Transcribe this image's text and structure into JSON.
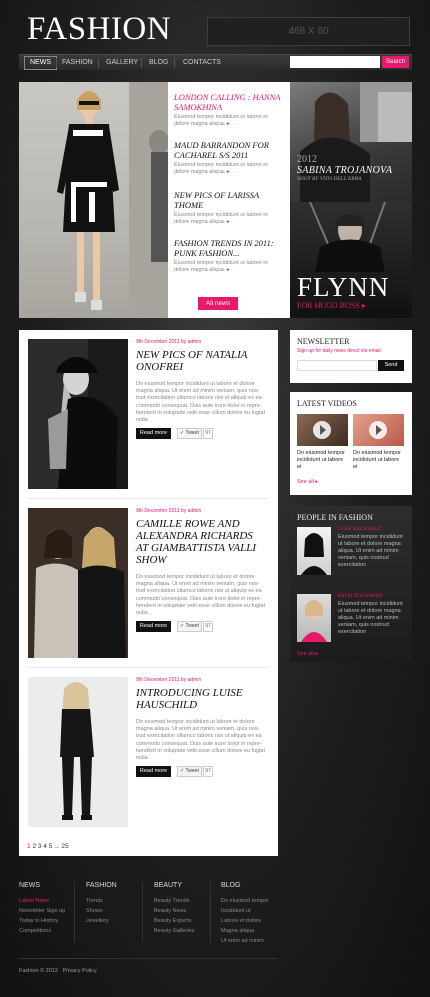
{
  "logo": "FASHION",
  "banner": "468 X 60",
  "nav": [
    "NEWS",
    "FASHION",
    "GALLERY",
    "BLOG",
    "CONTACTS"
  ],
  "search": {
    "button": "Search"
  },
  "hero": {
    "items": [
      {
        "title": "LONDON CALLING : HANNA SAMOKHINA",
        "desc": "Eiusmod tempor incididunt ut labore et dolore magna aliqua.",
        "highlight": true
      },
      {
        "title": "MAUD BARRANDON FOR CACHAREL S/S 2011",
        "desc": "Eiusmod tempor incididunt ut labore et dolore magna aliqua."
      },
      {
        "title": "NEW PICS OF LARISSA THOME",
        "desc": "Eiusmod tempor incididunt ut labore et dolore magna aliqua."
      },
      {
        "title": "FASHION TRENDS IN 2011: PUNK FASHION...",
        "desc": "Eiusmod tempor incididunt ut labore et dolore magna aliqua."
      }
    ],
    "all_news": "All news",
    "side1": {
      "year": "2012",
      "name": "SABINA TROJANOVA",
      "sub": "SHOT BY VITO DELL'ERBA"
    },
    "side2": {
      "name": "FLYNN",
      "sub": "FOR HUGO BOSS"
    }
  },
  "articles": [
    {
      "date": "9th December 2011 by admin",
      "title": "NEW PICS OF NATALIA ONOFREI",
      "text": "Do eiusmod tempor incididunt ut labore et dolore magna aliqua. Ut enim ad minim veniam, quis nos-trud exercitation ullamco laboris nisi ut aliquip ex ea commodo consequat. Duis aute irure dolor in repre-henderit in voluptate velit esse cillum dolore eu fugiat nulla.",
      "read_more": "Read more",
      "tweet": "Tweet",
      "count": "97"
    },
    {
      "date": "9th December 2011 by admin",
      "title": "CAMILLE ROWE AND ALEXANDRA RICHARDS AT GIAMBATTISTA VALLI SHOW",
      "text": "Do eiusmod tempor incididunt ut labore et dolore magna aliqua. Ut enim ad minim veniam, quis nos-trud exercitation ullamco laboris nisi ut aliquip ex ea commodo consequat. Duis aute irure dolor in repre-henderit in voluptate velit esse cillum dolore eu fugiat nulla.",
      "read_more": "Read more",
      "tweet": "Tweet",
      "count": "97"
    },
    {
      "date": "9th December 2011 by admin",
      "title": "INTRODUCING LUISE HAUSCHILD",
      "text": "Do eiusmod tempor incididunt ut labore et dolore magna aliqua. Ut enim ad minim veniam, quis nos-trud exercitation ullamco laboris nisi ut aliquip ex ea commodo consequat. Duis aute irure dolor in repre-henderit in voluptate velit esse cillum dolore eu fugiat nulla.",
      "read_more": "Read more",
      "tweet": "Tweet",
      "count": "97"
    }
  ],
  "pagination": {
    "current": "1",
    "rest": "2 3 4 5 ... 25"
  },
  "newsletter": {
    "title": "NEWSLETTER",
    "sub": "Sign up for daily news direct via email",
    "button": "Send"
  },
  "videos": {
    "title": "LATEST VIDEOS",
    "items": [
      "Do eiusmod tempor incididunt ut labore et",
      "Do eiusmod tempor incididunt ut labore et"
    ],
    "see_all": "See all"
  },
  "people": {
    "title": "PEOPLE IN FASHION",
    "items": [
      {
        "name": "LUISE HAUSCHILD",
        "desc": "Eiusmod tempor incididunt ut labore et dolore magna aliqua. Ut enim ad minim veniam, quis nostrud exercitation"
      },
      {
        "name": "KATYA DOLINSKAYA",
        "desc": "Eiusmod tempor incididunt ut labore et dolore magna aliqua. Ut enim ad minim veniam, quis nostrud exercitation"
      }
    ],
    "see_all": "See all"
  },
  "footer": {
    "columns": [
      {
        "head": "NEWS",
        "links": [
          "Latest News",
          "Newsletter Sign up",
          "Today in History",
          "Competitions"
        ]
      },
      {
        "head": "FASHION",
        "links": [
          "Trends",
          "Shows",
          "Jewellery"
        ]
      },
      {
        "head": "BEAUTY",
        "links": [
          "Beauty Trends",
          "Beauty News",
          "Beauty Experts",
          "Beauty Galleries"
        ]
      },
      {
        "head": "BLOG",
        "links": [
          "Do eiusmod tempor",
          "Incididunt ut",
          "Labore et dolore",
          "Magna aliqua",
          "Ut enim ad minim"
        ]
      }
    ],
    "copyright": "Fashion © 2012",
    "privacy": "Privacy Policy"
  },
  "colors": {
    "accent": "#e8186d",
    "bg": "#1e1e1e"
  }
}
